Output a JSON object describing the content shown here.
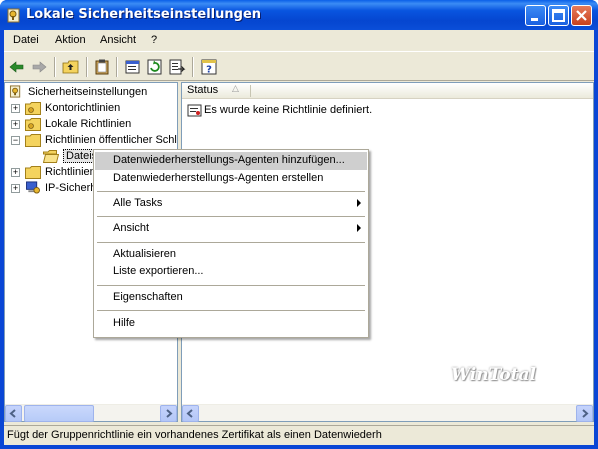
{
  "window": {
    "title": "Lokale Sicherheitseinstellungen",
    "minimize": "_",
    "maximize": "□",
    "close": "×"
  },
  "menu": [
    "Datei",
    "Aktion",
    "Ansicht",
    "?"
  ],
  "toolbar": {
    "icons": [
      "back-arrow-icon",
      "forward-arrow-icon",
      "up-folder-icon",
      "clipboard-icon",
      "properties-icon",
      "refresh-icon",
      "export-list-icon",
      "help-icon"
    ]
  },
  "tree": {
    "root": "Sicherheitseinstellungen",
    "items": [
      {
        "label": "Kontorichtlinien",
        "expander": "+"
      },
      {
        "label": "Lokale Richtlinien",
        "expander": "+"
      },
      {
        "label": "Richtlinien öffentlicher Schl",
        "expander": "−"
      },
      {
        "label": "Dateis",
        "expander": ""
      },
      {
        "label": "Richtlinien",
        "expander": "+"
      },
      {
        "label": "IP-Sicherh",
        "expander": "+"
      }
    ]
  },
  "list": {
    "column": "Status",
    "sort_indicator": "△",
    "message": "Es wurde keine Richtlinie definiert."
  },
  "context_menu": {
    "items": [
      {
        "label": "Datenwiederherstellungs-Agenten hinzufügen...",
        "highlighted": true
      },
      {
        "label": "Datenwiederherstellungs-Agenten erstellen"
      },
      {
        "label": "Alle Tasks",
        "submenu": true
      },
      {
        "label": "Ansicht",
        "submenu": true
      },
      {
        "label": "Aktualisieren"
      },
      {
        "label": "Liste exportieren..."
      },
      {
        "label": "Eigenschaften"
      },
      {
        "label": "Hilfe"
      }
    ]
  },
  "status_bar": "Fügt der Gruppenrichtlinie ein vorhandenes Zertifikat als einen Datenwiederh",
  "watermark": "WinTotal",
  "colors": {
    "title_blue": "#0a4ed8",
    "menu_highlight": "#cfcfcf",
    "face": "#ece9d8"
  }
}
